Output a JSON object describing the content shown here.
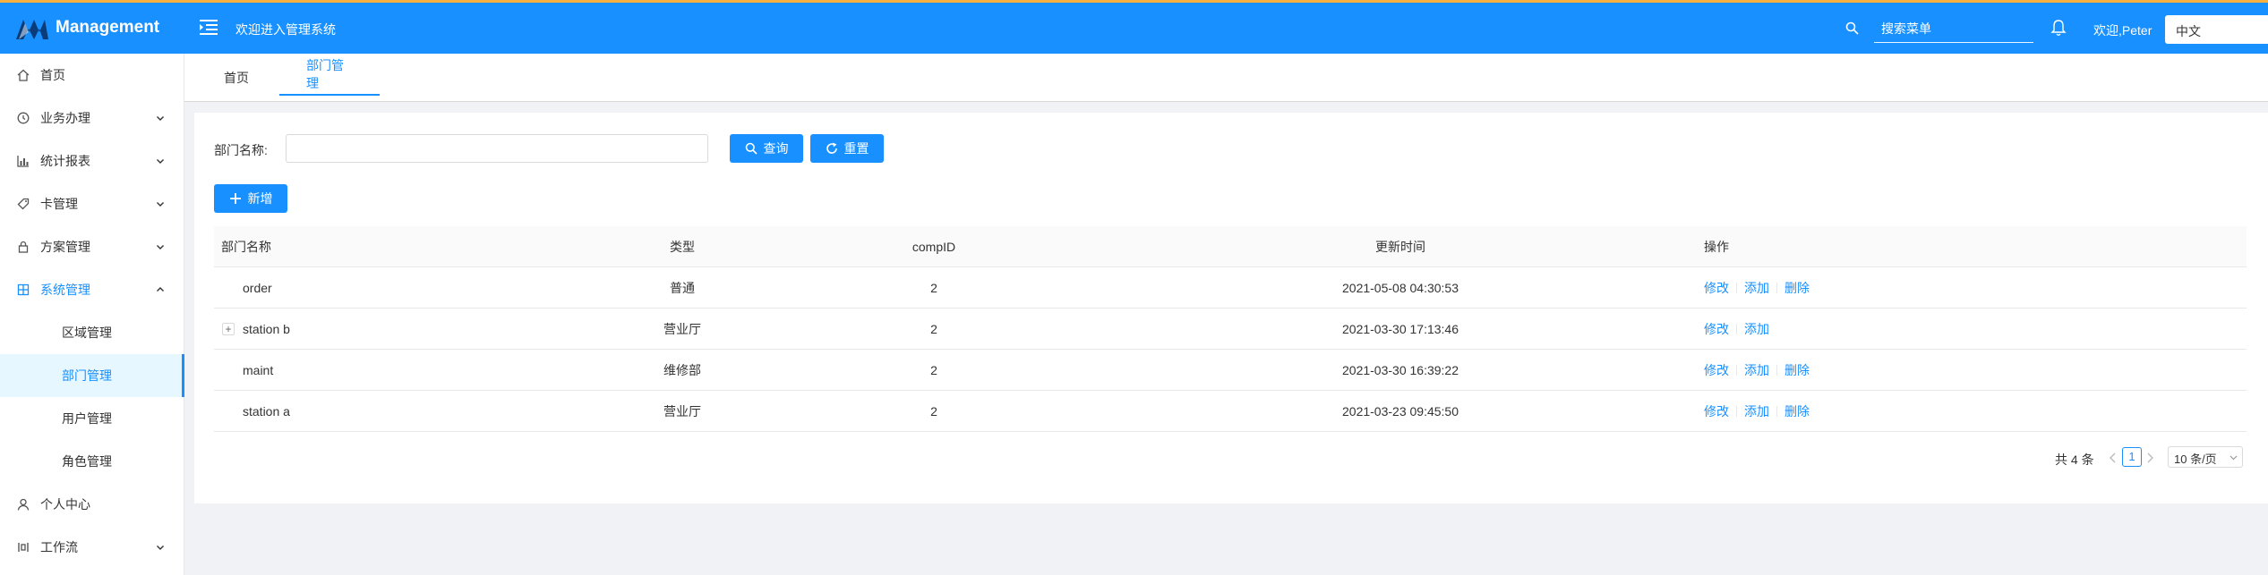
{
  "header": {
    "logo_text": "Management",
    "welcome_title": "欢迎进入管理系统",
    "search_placeholder": "搜索菜单",
    "welcome_user": "欢迎,Peter",
    "language": "中文",
    "colors": {
      "primary": "#1890ff",
      "top_border": "#f5b041"
    }
  },
  "sidebar": {
    "items": [
      {
        "label": "首页",
        "icon": "home-icon"
      },
      {
        "label": "业务办理",
        "icon": "clock-icon"
      },
      {
        "label": "统计报表",
        "icon": "bar-chart-icon"
      },
      {
        "label": "卡管理",
        "icon": "tag-icon"
      },
      {
        "label": "方案管理",
        "icon": "lock-icon"
      },
      {
        "label": "系统管理",
        "icon": "grid-icon"
      },
      {
        "label": "区域管理"
      },
      {
        "label": "部门管理"
      },
      {
        "label": "用户管理"
      },
      {
        "label": "角色管理"
      },
      {
        "label": "个人中心",
        "icon": "user-icon"
      },
      {
        "label": "工作流",
        "icon": "workflow-icon"
      }
    ]
  },
  "tabs": [
    {
      "label": "首页"
    },
    {
      "label": "部门管理",
      "active": true
    }
  ],
  "filter": {
    "dept_label": "部门名称:",
    "dept_value": "",
    "query_label": "查询",
    "reset_label": "重置"
  },
  "toolbar": {
    "add_label": "新增"
  },
  "table": {
    "columns": [
      "部门名称",
      "类型",
      "compID",
      "更新时间",
      "操作"
    ],
    "rows": [
      {
        "name": "order",
        "type": "普通",
        "compID": "2",
        "updated": "2021-05-08 04:30:53",
        "ops": [
          "修改",
          "添加",
          "删除"
        ],
        "expandable": false
      },
      {
        "name": "station b",
        "type": "营业厅",
        "compID": "2",
        "updated": "2021-03-30 17:13:46",
        "ops": [
          "修改",
          "添加"
        ],
        "expandable": true
      },
      {
        "name": "maint",
        "type": "维修部",
        "compID": "2",
        "updated": "2021-03-30 16:39:22",
        "ops": [
          "修改",
          "添加",
          "删除"
        ],
        "expandable": false
      },
      {
        "name": "station a",
        "type": "营业厅",
        "compID": "2",
        "updated": "2021-03-23 09:45:50",
        "ops": [
          "修改",
          "添加",
          "删除"
        ],
        "expandable": false
      }
    ]
  },
  "pagination": {
    "total_text": "共 4 条",
    "current_page": "1",
    "page_size": "10 条/页"
  }
}
